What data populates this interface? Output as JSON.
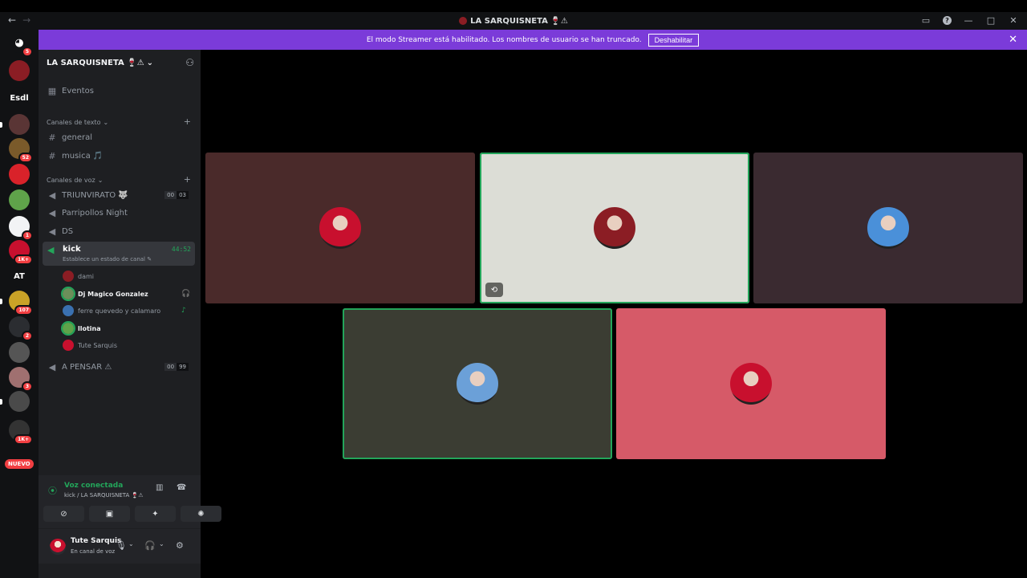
{
  "titlebar": {
    "back": "←",
    "forward": "→",
    "title": "LA SARQUISNETA 🍷⚠",
    "icons": [
      "inbox-icon",
      "help-icon",
      "minimize-icon",
      "maximize-icon",
      "close-icon"
    ],
    "glyphs": {
      "inbox": "▭",
      "help": "?",
      "minimize": "—",
      "maximize": "□",
      "close": "✕"
    }
  },
  "banner": {
    "message": "El modo Streamer está habilitado. Los nombres de usuario se han truncado.",
    "button": "Deshabilitar",
    "close": "✕",
    "color": "#7b3bd9"
  },
  "rail": {
    "home_badge": "5",
    "servers": [
      {
        "label": "",
        "badge": "",
        "color": "#8b1d24"
      },
      {
        "label": "Esdl",
        "badge": "",
        "color": "#111214"
      },
      {
        "label": "",
        "badge": "",
        "color": "#5a3535"
      },
      {
        "label": "",
        "badge": "52",
        "color": "#7a5a2a"
      },
      {
        "label": "",
        "badge": "",
        "color": "#d9222a"
      },
      {
        "label": "",
        "badge": "",
        "color": "#5fa34a"
      },
      {
        "label": "",
        "badge": "1",
        "color": "#f2f3f5"
      },
      {
        "label": "",
        "badge": "1K+",
        "color": "#c8102e"
      },
      {
        "label": "AT",
        "badge": "",
        "color": "#111214"
      },
      {
        "label": "",
        "badge": "107",
        "color": "#c9a227"
      },
      {
        "label": "",
        "badge": "2",
        "color": "#2b2d31"
      },
      {
        "label": "",
        "badge": "",
        "color": "#555555"
      },
      {
        "label": "",
        "badge": "3",
        "color": "#a07070"
      },
      {
        "label": "",
        "badge": "",
        "color": "#4a4a4a"
      },
      {
        "label": "",
        "badge": "1K+",
        "color": "#333333"
      }
    ],
    "nuevo": "NUEVO"
  },
  "sidebar": {
    "guild_name": "LA SARQUISNETA 🍷⚠",
    "chevron": "⌄",
    "events": "Eventos",
    "text_category": "Canales de texto",
    "text_channels": [
      {
        "name": "general"
      },
      {
        "name": "musica 🎵"
      }
    ],
    "voice_category": "Canales de voz",
    "voice_channels": [
      {
        "name": "TRIUNVIRATO 🐺",
        "count_a": "00",
        "count_b": "03"
      },
      {
        "name": "Parripollos Night"
      },
      {
        "name": "DS"
      }
    ],
    "active_channel": {
      "name": "kick",
      "status": "Establece un estado de canal ✎",
      "timer": "44:52"
    },
    "members": [
      {
        "name": "dami",
        "bold": false,
        "color": "#8b1d24"
      },
      {
        "name": "Dj Magico Gonzalez",
        "bold": true,
        "color": "#6b8f5a"
      },
      {
        "name": "ferre quevedo y calamaro",
        "bold": false,
        "color": "#3a70b0"
      },
      {
        "name": "llotina",
        "bold": true,
        "color": "#5fa34a"
      },
      {
        "name": "Tute Sarquis",
        "bold": false,
        "color": "#c8102e"
      }
    ],
    "last_voice_channel": {
      "name": "A PENSAR ⚠",
      "count_a": "00",
      "count_b": "99"
    }
  },
  "voice_panel": {
    "status": "Voz conectada",
    "channel": "kick / LA SARQUISNETA 🍷⚠"
  },
  "user_panel": {
    "username": "Tute Sarquis",
    "status": "En canal de voz"
  },
  "tiles": [
    {
      "bg": "#4a2a2a",
      "speaking": false,
      "avatar": "#c8102e",
      "avatar_name": "avatar-red-jersey"
    },
    {
      "bg": "#dcddd6",
      "speaking": true,
      "avatar": "#8b1d24",
      "avatar_name": "avatar-logo"
    },
    {
      "bg": "#3a2a30",
      "speaking": false,
      "avatar": "#4a90d9",
      "avatar_name": "avatar-man-suit"
    },
    {
      "bg": "#3b3d33",
      "speaking": true,
      "avatar": "#6ba0d8",
      "avatar_name": "avatar-cow"
    },
    {
      "bg": "#d65a68",
      "speaking": false,
      "avatar": "#c8102e",
      "avatar_name": "avatar-player-red"
    }
  ]
}
